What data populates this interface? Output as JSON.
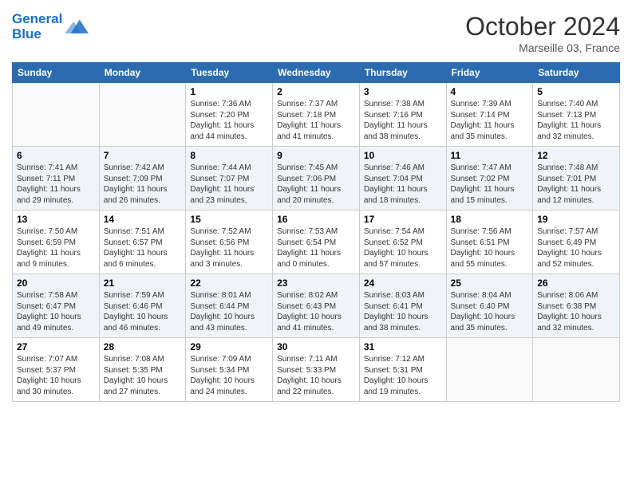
{
  "logo": {
    "line1": "General",
    "line2": "Blue"
  },
  "title": "October 2024",
  "location": "Marseille 03, France",
  "header_days": [
    "Sunday",
    "Monday",
    "Tuesday",
    "Wednesday",
    "Thursday",
    "Friday",
    "Saturday"
  ],
  "weeks": [
    [
      {
        "day": "",
        "sunrise": "",
        "sunset": "",
        "daylight": ""
      },
      {
        "day": "",
        "sunrise": "",
        "sunset": "",
        "daylight": ""
      },
      {
        "day": "1",
        "sunrise": "Sunrise: 7:36 AM",
        "sunset": "Sunset: 7:20 PM",
        "daylight": "Daylight: 11 hours and 44 minutes."
      },
      {
        "day": "2",
        "sunrise": "Sunrise: 7:37 AM",
        "sunset": "Sunset: 7:18 PM",
        "daylight": "Daylight: 11 hours and 41 minutes."
      },
      {
        "day": "3",
        "sunrise": "Sunrise: 7:38 AM",
        "sunset": "Sunset: 7:16 PM",
        "daylight": "Daylight: 11 hours and 38 minutes."
      },
      {
        "day": "4",
        "sunrise": "Sunrise: 7:39 AM",
        "sunset": "Sunset: 7:14 PM",
        "daylight": "Daylight: 11 hours and 35 minutes."
      },
      {
        "day": "5",
        "sunrise": "Sunrise: 7:40 AM",
        "sunset": "Sunset: 7:13 PM",
        "daylight": "Daylight: 11 hours and 32 minutes."
      }
    ],
    [
      {
        "day": "6",
        "sunrise": "Sunrise: 7:41 AM",
        "sunset": "Sunset: 7:11 PM",
        "daylight": "Daylight: 11 hours and 29 minutes."
      },
      {
        "day": "7",
        "sunrise": "Sunrise: 7:42 AM",
        "sunset": "Sunset: 7:09 PM",
        "daylight": "Daylight: 11 hours and 26 minutes."
      },
      {
        "day": "8",
        "sunrise": "Sunrise: 7:44 AM",
        "sunset": "Sunset: 7:07 PM",
        "daylight": "Daylight: 11 hours and 23 minutes."
      },
      {
        "day": "9",
        "sunrise": "Sunrise: 7:45 AM",
        "sunset": "Sunset: 7:06 PM",
        "daylight": "Daylight: 11 hours and 20 minutes."
      },
      {
        "day": "10",
        "sunrise": "Sunrise: 7:46 AM",
        "sunset": "Sunset: 7:04 PM",
        "daylight": "Daylight: 11 hours and 18 minutes."
      },
      {
        "day": "11",
        "sunrise": "Sunrise: 7:47 AM",
        "sunset": "Sunset: 7:02 PM",
        "daylight": "Daylight: 11 hours and 15 minutes."
      },
      {
        "day": "12",
        "sunrise": "Sunrise: 7:48 AM",
        "sunset": "Sunset: 7:01 PM",
        "daylight": "Daylight: 11 hours and 12 minutes."
      }
    ],
    [
      {
        "day": "13",
        "sunrise": "Sunrise: 7:50 AM",
        "sunset": "Sunset: 6:59 PM",
        "daylight": "Daylight: 11 hours and 9 minutes."
      },
      {
        "day": "14",
        "sunrise": "Sunrise: 7:51 AM",
        "sunset": "Sunset: 6:57 PM",
        "daylight": "Daylight: 11 hours and 6 minutes."
      },
      {
        "day": "15",
        "sunrise": "Sunrise: 7:52 AM",
        "sunset": "Sunset: 6:56 PM",
        "daylight": "Daylight: 11 hours and 3 minutes."
      },
      {
        "day": "16",
        "sunrise": "Sunrise: 7:53 AM",
        "sunset": "Sunset: 6:54 PM",
        "daylight": "Daylight: 11 hours and 0 minutes."
      },
      {
        "day": "17",
        "sunrise": "Sunrise: 7:54 AM",
        "sunset": "Sunset: 6:52 PM",
        "daylight": "Daylight: 10 hours and 57 minutes."
      },
      {
        "day": "18",
        "sunrise": "Sunrise: 7:56 AM",
        "sunset": "Sunset: 6:51 PM",
        "daylight": "Daylight: 10 hours and 55 minutes."
      },
      {
        "day": "19",
        "sunrise": "Sunrise: 7:57 AM",
        "sunset": "Sunset: 6:49 PM",
        "daylight": "Daylight: 10 hours and 52 minutes."
      }
    ],
    [
      {
        "day": "20",
        "sunrise": "Sunrise: 7:58 AM",
        "sunset": "Sunset: 6:47 PM",
        "daylight": "Daylight: 10 hours and 49 minutes."
      },
      {
        "day": "21",
        "sunrise": "Sunrise: 7:59 AM",
        "sunset": "Sunset: 6:46 PM",
        "daylight": "Daylight: 10 hours and 46 minutes."
      },
      {
        "day": "22",
        "sunrise": "Sunrise: 8:01 AM",
        "sunset": "Sunset: 6:44 PM",
        "daylight": "Daylight: 10 hours and 43 minutes."
      },
      {
        "day": "23",
        "sunrise": "Sunrise: 8:02 AM",
        "sunset": "Sunset: 6:43 PM",
        "daylight": "Daylight: 10 hours and 41 minutes."
      },
      {
        "day": "24",
        "sunrise": "Sunrise: 8:03 AM",
        "sunset": "Sunset: 6:41 PM",
        "daylight": "Daylight: 10 hours and 38 minutes."
      },
      {
        "day": "25",
        "sunrise": "Sunrise: 8:04 AM",
        "sunset": "Sunset: 6:40 PM",
        "daylight": "Daylight: 10 hours and 35 minutes."
      },
      {
        "day": "26",
        "sunrise": "Sunrise: 8:06 AM",
        "sunset": "Sunset: 6:38 PM",
        "daylight": "Daylight: 10 hours and 32 minutes."
      }
    ],
    [
      {
        "day": "27",
        "sunrise": "Sunrise: 7:07 AM",
        "sunset": "Sunset: 5:37 PM",
        "daylight": "Daylight: 10 hours and 30 minutes."
      },
      {
        "day": "28",
        "sunrise": "Sunrise: 7:08 AM",
        "sunset": "Sunset: 5:35 PM",
        "daylight": "Daylight: 10 hours and 27 minutes."
      },
      {
        "day": "29",
        "sunrise": "Sunrise: 7:09 AM",
        "sunset": "Sunset: 5:34 PM",
        "daylight": "Daylight: 10 hours and 24 minutes."
      },
      {
        "day": "30",
        "sunrise": "Sunrise: 7:11 AM",
        "sunset": "Sunset: 5:33 PM",
        "daylight": "Daylight: 10 hours and 22 minutes."
      },
      {
        "day": "31",
        "sunrise": "Sunrise: 7:12 AM",
        "sunset": "Sunset: 5:31 PM",
        "daylight": "Daylight: 10 hours and 19 minutes."
      },
      {
        "day": "",
        "sunrise": "",
        "sunset": "",
        "daylight": ""
      },
      {
        "day": "",
        "sunrise": "",
        "sunset": "",
        "daylight": ""
      }
    ]
  ]
}
